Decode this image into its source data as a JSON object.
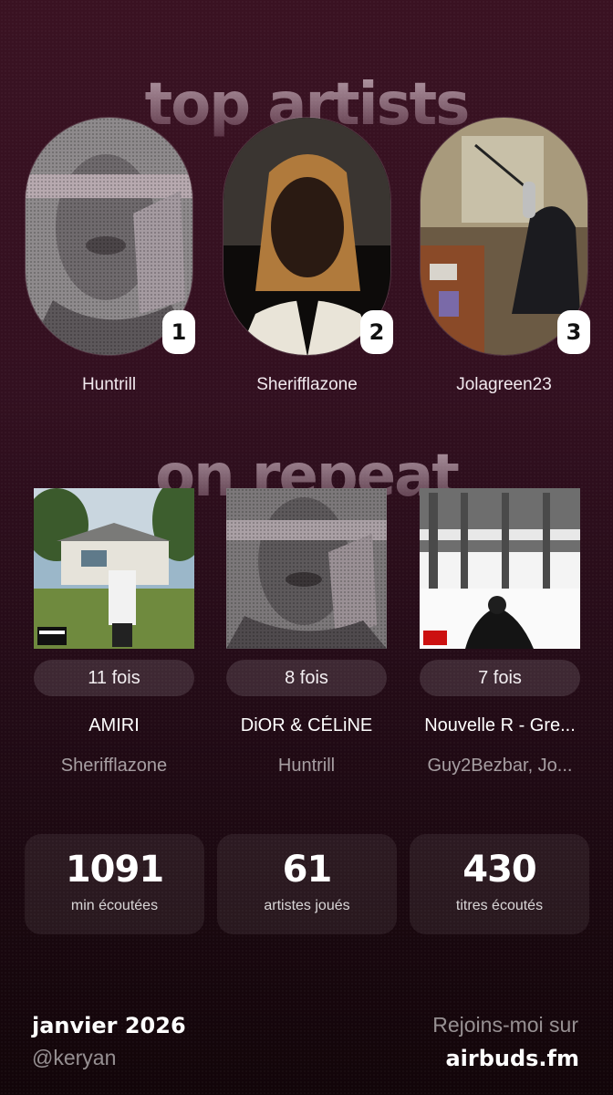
{
  "header": {
    "top_artists_title": "top artists",
    "on_repeat_title": "on repeat"
  },
  "top_artists": [
    {
      "rank": "1",
      "name": "Huntrill"
    },
    {
      "rank": "2",
      "name": "Sherifflazone"
    },
    {
      "rank": "3",
      "name": "Jolagreen23"
    }
  ],
  "on_repeat": [
    {
      "count": "11 fois",
      "title": "AMIRI",
      "artists": "Sherifflazone"
    },
    {
      "count": "8 fois",
      "title": "DiOR & CÉLiNE",
      "artists": "Huntrill"
    },
    {
      "count": "7 fois",
      "title": "Nouvelle R - Gre...",
      "artists": "Guy2Bezbar, Jo..."
    }
  ],
  "stats": [
    {
      "value": "1091",
      "label": "min écoutées"
    },
    {
      "value": "61",
      "label": "artistes joués"
    },
    {
      "value": "430",
      "label": "titres écoutés"
    }
  ],
  "footer": {
    "month": "janvier 2026",
    "username": "@keryan",
    "join_text": "Rejoins-moi sur",
    "brand": "airbuds.fm"
  },
  "colors": {
    "background_top": "#3a1222",
    "background_bottom": "#120509",
    "badge": "#ffffff"
  }
}
